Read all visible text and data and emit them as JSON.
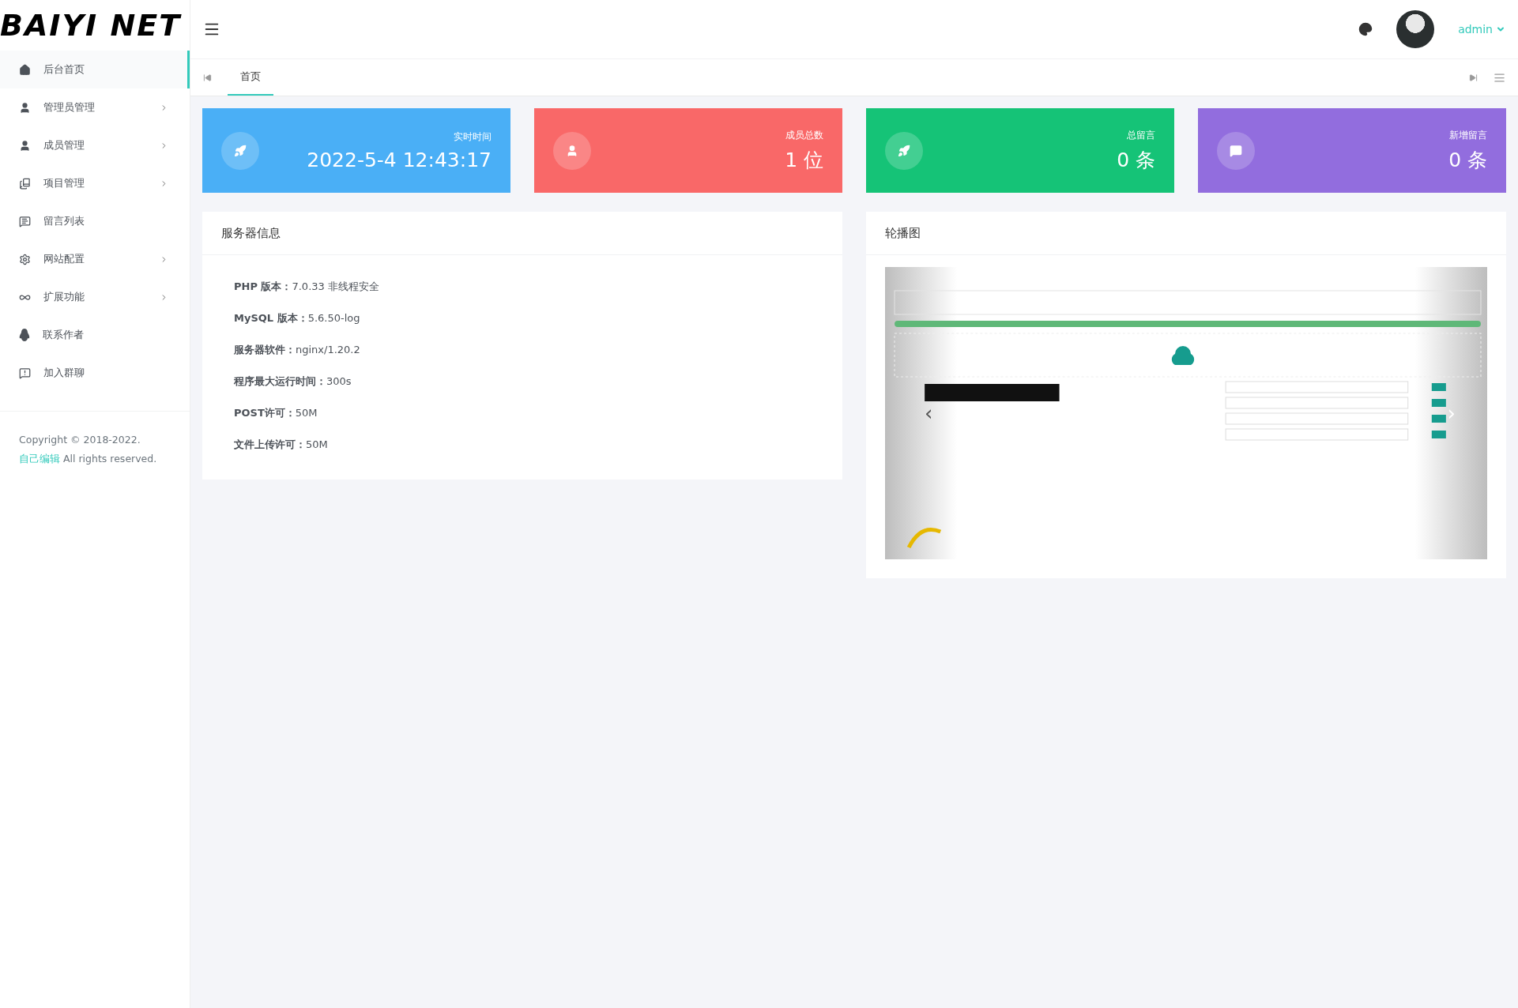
{
  "logo": "BAIYI NET",
  "header": {
    "user": "admin"
  },
  "sidebar": {
    "items": [
      {
        "label": "后台首页",
        "selected": true,
        "has_submenu": false
      },
      {
        "label": "管理员管理",
        "selected": false,
        "has_submenu": true
      },
      {
        "label": "成员管理",
        "selected": false,
        "has_submenu": true
      },
      {
        "label": "项目管理",
        "selected": false,
        "has_submenu": true
      },
      {
        "label": "留言列表",
        "selected": false,
        "has_submenu": false
      },
      {
        "label": "网站配置",
        "selected": false,
        "has_submenu": true
      },
      {
        "label": "扩展功能",
        "selected": false,
        "has_submenu": true
      },
      {
        "label": "联系作者",
        "selected": false,
        "has_submenu": false
      },
      {
        "label": "加入群聊",
        "selected": false,
        "has_submenu": false
      }
    ],
    "footer": {
      "text": "Copyright © 2018-2022.",
      "link": "自己编辑",
      "suffix": "All rights reserved."
    }
  },
  "tabs": [
    {
      "label": "首页",
      "selected": true
    }
  ],
  "stats": [
    {
      "title": "实时时间",
      "value": "2022-5-4 12:43:17",
      "color": "#4aaff6"
    },
    {
      "title": "成员总数",
      "value": "1 位",
      "color": "#f96868"
    },
    {
      "title": "总留言",
      "value": "0 条",
      "color": "#15c377"
    },
    {
      "title": "新增留言",
      "value": "0 条",
      "color": "#926dde"
    }
  ],
  "server_info": {
    "title": "服务器信息",
    "rows": [
      {
        "label": "PHP 版本：",
        "value": "7.0.33 非线程安全"
      },
      {
        "label": "MySQL 版本：",
        "value": "5.6.50-log"
      },
      {
        "label": "服务器软件：",
        "value": "nginx/1.20.2"
      },
      {
        "label": "程序最大运行时间：",
        "value": "300s"
      },
      {
        "label": "POST许可：",
        "value": "50M"
      },
      {
        "label": "文件上传许可：",
        "value": "50M"
      }
    ]
  },
  "carousel": {
    "title": "轮播图",
    "prev": "‹",
    "next": "›"
  }
}
